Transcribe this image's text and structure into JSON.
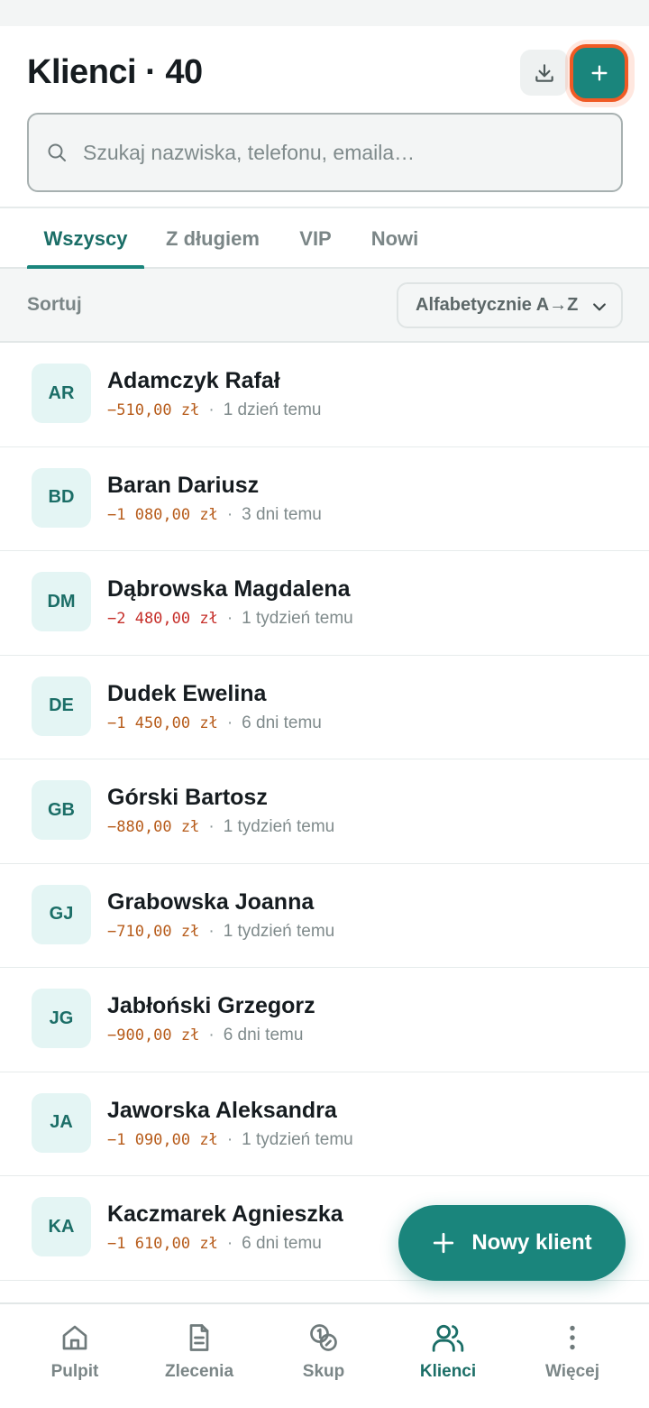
{
  "header": {
    "title": "Klienci · 40",
    "export_icon": "download-icon",
    "add_icon": "plus-icon"
  },
  "search": {
    "placeholder": "Szukaj nazwiska, telefonu, emaila…",
    "icon": "search-icon"
  },
  "tabs": [
    {
      "label": "Wszyscy",
      "active": true
    },
    {
      "label": "Z długiem",
      "active": false
    },
    {
      "label": "VIP",
      "active": false
    },
    {
      "label": "Nowi",
      "active": false
    }
  ],
  "sort": {
    "label": "Sortuj",
    "value": "Alfabetycznie A→Z"
  },
  "clients": [
    {
      "initials": "AR",
      "name": "Adamczyk Rafał",
      "debt": "−510,00 zł",
      "separator": "·",
      "last_seen": "1 dzień temu"
    },
    {
      "initials": "BD",
      "name": "Baran Dariusz",
      "debt": "−1 080,00 zł",
      "separator": "·",
      "last_seen": "3 dni temu"
    },
    {
      "initials": "DM",
      "name": "Dąbrowska Magdalena",
      "debt": "−2 480,00 zł",
      "separator": "·",
      "last_seen": "1 tydzień temu"
    },
    {
      "initials": "DE",
      "name": "Dudek Ewelina",
      "debt": "−1 450,00 zł",
      "separator": "·",
      "last_seen": "6 dni temu"
    },
    {
      "initials": "GB",
      "name": "Górski Bartosz",
      "debt": "−880,00 zł",
      "separator": "·",
      "last_seen": "1 tydzień temu"
    },
    {
      "initials": "GJ",
      "name": "Grabowska Joanna",
      "debt": "−710,00 zł",
      "separator": "·",
      "last_seen": "1 tydzień temu"
    },
    {
      "initials": "JG",
      "name": "Jabłoński Grzegorz",
      "debt": "−900,00 zł",
      "separator": "·",
      "last_seen": "6 dni temu"
    },
    {
      "initials": "JA",
      "name": "Jaworska Aleksandra",
      "debt": "−1 090,00 zł",
      "separator": "·",
      "last_seen": "1 tydzień temu"
    },
    {
      "initials": "KA",
      "name": "Kaczmarek Agnieszka",
      "debt": "−1 610,00 zł",
      "separator": "·",
      "last_seen": "6 dni temu"
    }
  ],
  "fab": {
    "label": "Nowy klient",
    "icon": "plus-icon"
  },
  "bottom_nav": [
    {
      "label": "Pulpit",
      "icon": "home-icon",
      "active": false
    },
    {
      "label": "Zlecenia",
      "icon": "document-icon",
      "active": false
    },
    {
      "label": "Skup",
      "icon": "coins-icon",
      "active": false
    },
    {
      "label": "Klienci",
      "icon": "users-icon",
      "active": true
    },
    {
      "label": "Więcej",
      "icon": "more-vertical-icon",
      "active": false
    }
  ],
  "colors": {
    "accent": "#1a857c",
    "accent_text": "#1b6e67",
    "debt": "#b75c1b",
    "debt_high": "#c62f2a",
    "highlight_ring": "#f05a24"
  }
}
